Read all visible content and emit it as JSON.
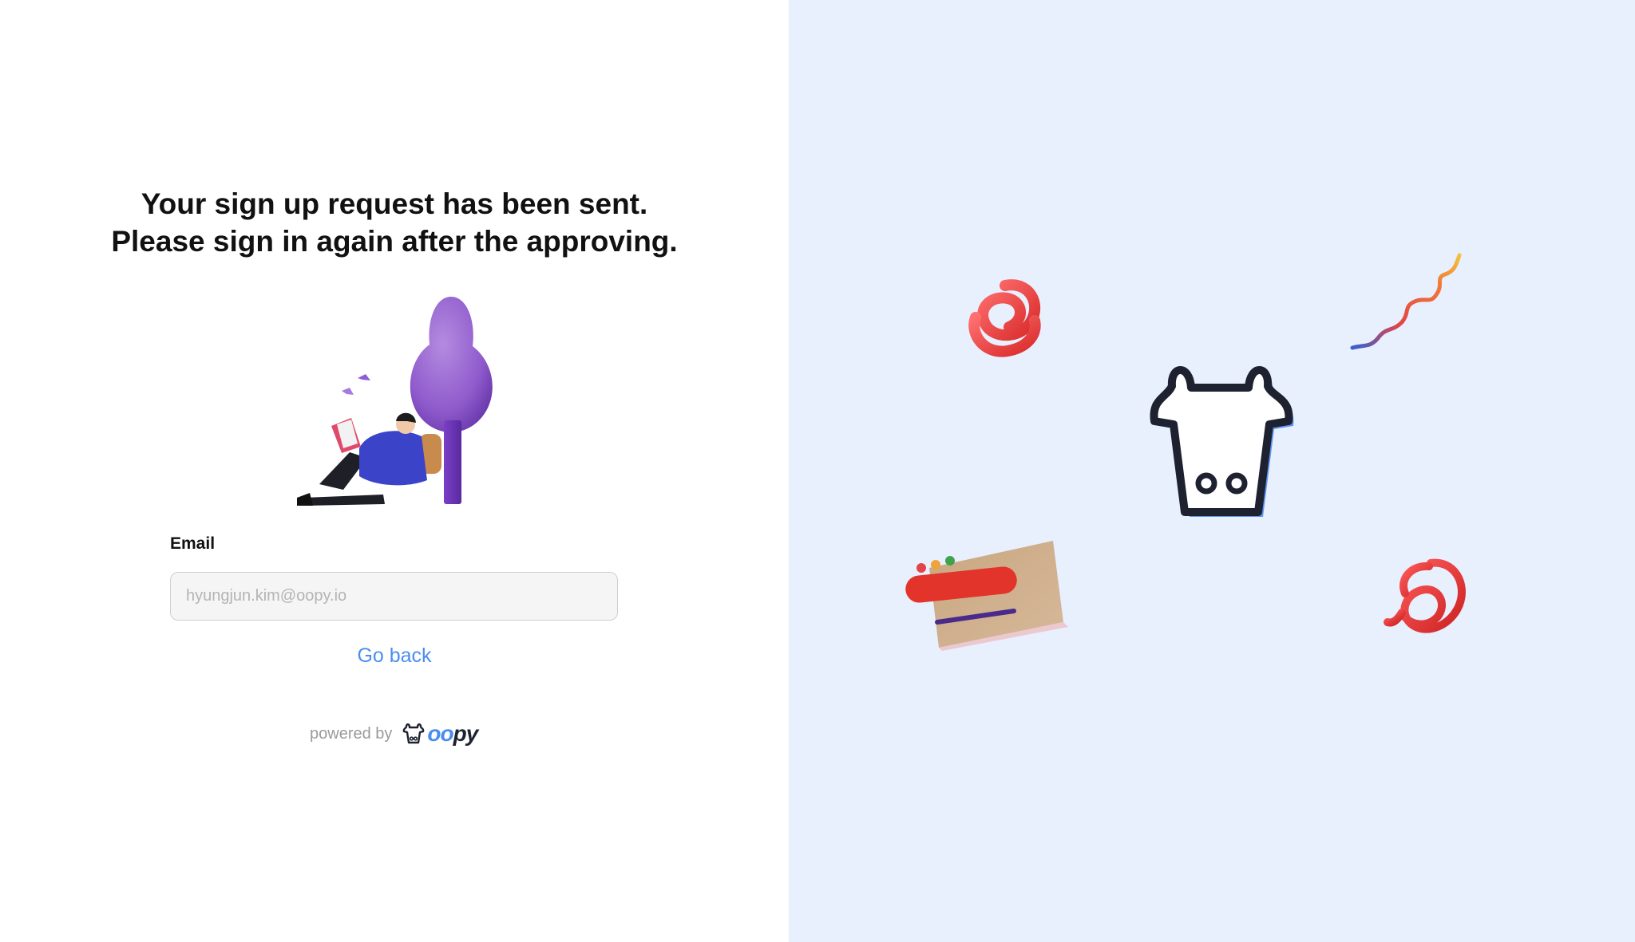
{
  "heading": {
    "line1": "Your sign up request has been sent.",
    "line2": "Please sign in again after the approving."
  },
  "form": {
    "email_label": "Email",
    "email_placeholder": "hyungjun.kim@oopy.io",
    "email_value": ""
  },
  "actions": {
    "go_back_label": "Go back"
  },
  "footer": {
    "powered_by": "powered by",
    "brand_part1": "oo",
    "brand_part2": "py"
  },
  "colors": {
    "left_background": "#ffffff",
    "right_background": "#e8effd",
    "link": "#4a8df0",
    "brand_blue": "#4a8df0",
    "brand_dark": "#1e2230"
  },
  "icons": {
    "hero": "person-reading-under-tree-illustration",
    "mascot": "cow-face-icon",
    "decorations": [
      "red-spiral",
      "rainbow-squiggle",
      "red-coil",
      "card-with-bar"
    ]
  }
}
